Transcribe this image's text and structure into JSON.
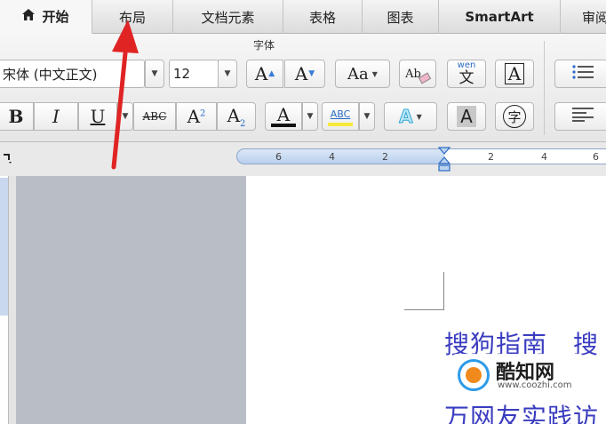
{
  "tabs": [
    {
      "label": "开始",
      "active": true
    },
    {
      "label": "布局"
    },
    {
      "label": "文档元素"
    },
    {
      "label": "表格"
    },
    {
      "label": "图表"
    },
    {
      "label": "SmartArt"
    },
    {
      "label": "审阅"
    }
  ],
  "ribbon": {
    "group_title": "字体",
    "font_name": "宋体 (中文正文)",
    "font_size": "12",
    "buttons": {
      "bold": "B",
      "italic": "I",
      "underline": "U",
      "strikethrough": "ABC",
      "superscript": "A2",
      "subscript": "A2",
      "font_color": "A",
      "highlight": "ABC",
      "text_effects": "A",
      "char_shading": "A",
      "enclose": "字",
      "grow": "A",
      "shrink": "A",
      "change_case": "Aa",
      "clear": "Ab",
      "phonetic_top": "wen",
      "phonetic_bottom": "文",
      "char_border": "A"
    }
  },
  "ruler": {
    "ticks": [
      "6",
      "4",
      "2",
      "2",
      "4",
      "6"
    ]
  },
  "document": {
    "line1": "搜狗指南　搜",
    "line2": "万网友实践访"
  },
  "watermark": {
    "name": "酷知网",
    "url": "www.coozhi.com"
  },
  "colors": {
    "font_color_bar": "#111111",
    "highlight_bar": "#f5ea3a",
    "doc_text": "#3a3cc0",
    "arrow": "#e02424"
  }
}
